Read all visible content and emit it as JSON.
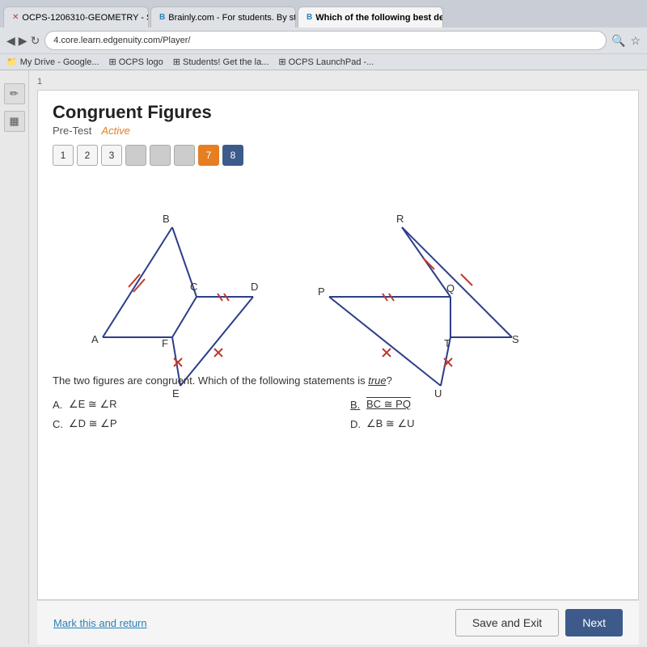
{
  "browser": {
    "tabs": [
      {
        "label": "OCPS-1206310-GEOMETRY - S...",
        "favicon": "✕",
        "active": false
      },
      {
        "label": "Brainly.com - For students. By st...",
        "favicon": "B",
        "active": false
      },
      {
        "label": "Which of the following best des...",
        "favicon": "B",
        "active": true
      }
    ],
    "address": "4.core.learn.edgenuity.com/Player/",
    "bookmarks": [
      {
        "label": "My Drive - Google..."
      },
      {
        "label": "OCPS logo"
      },
      {
        "label": "Students! Get the la..."
      },
      {
        "label": "OCPS LaunchPad -..."
      }
    ]
  },
  "page": {
    "breadcrumb": "1",
    "title": "Congruent Figures",
    "subtitle_pretest": "Pre-Test",
    "subtitle_status": "Active",
    "nav_buttons": [
      "1",
      "2",
      "3",
      "",
      "",
      "",
      "7",
      "8"
    ],
    "active_nav": 6,
    "current_nav": 7,
    "question_text": "The two figures are congruent. Which of the following statements is true?",
    "answers": [
      {
        "letter": "A.",
        "text": "∠E ≅ ∠R",
        "overline": false
      },
      {
        "letter": "B.",
        "text": "BC ≅ PQ",
        "overline": true,
        "selected": true
      },
      {
        "letter": "C.",
        "text": "∠D ≅ ∠P",
        "overline": false
      },
      {
        "letter": "D.",
        "text": "∠B ≅ ∠U",
        "overline": false
      }
    ],
    "mark_link": "Mark this and return",
    "save_button": "Save and Exit",
    "next_button": "Next"
  }
}
